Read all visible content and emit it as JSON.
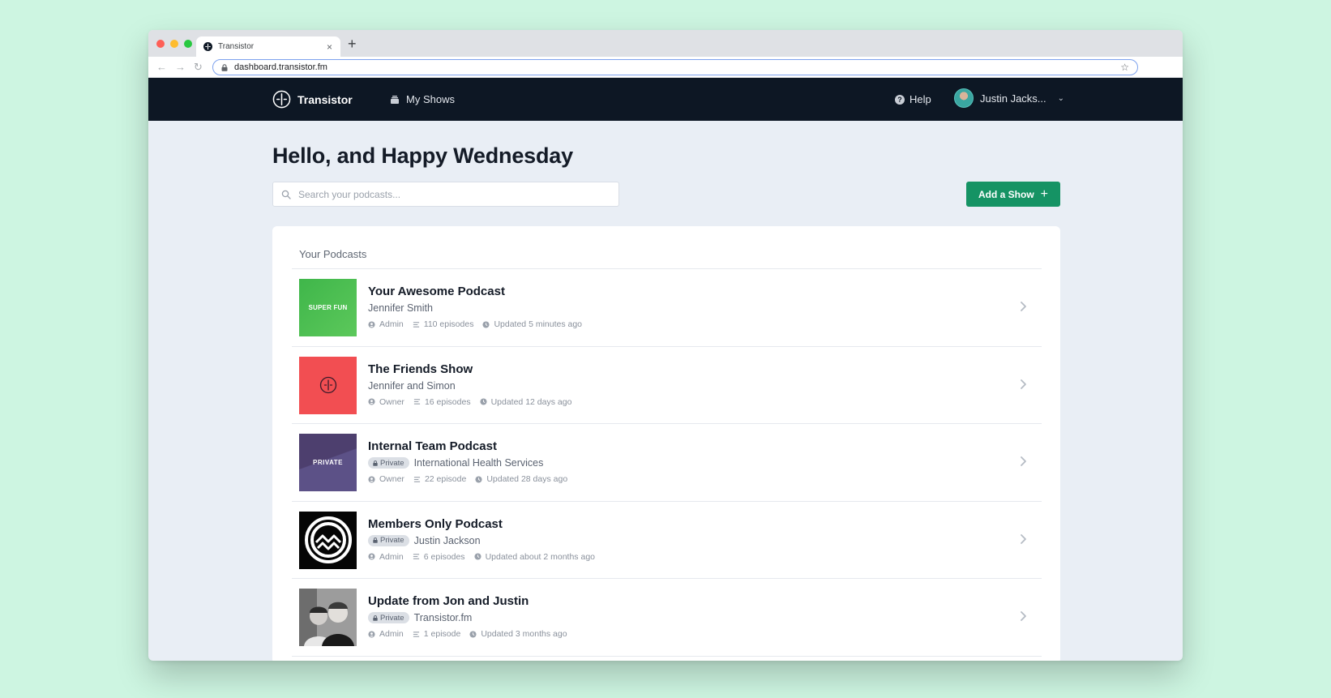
{
  "browser": {
    "tab_title": "Transistor",
    "tab_close": "×",
    "new_tab": "+",
    "url": "dashboard.transistor.fm",
    "back": "←",
    "forward": "→",
    "reload": "↻",
    "star": "☆"
  },
  "header": {
    "brand": "Transistor",
    "my_shows": "My Shows",
    "help": "Help",
    "help_glyph": "?",
    "user_name": "Justin Jacks...",
    "user_chevron": "⌄"
  },
  "main": {
    "greeting": "Hello, and Happy Wednesday",
    "search_placeholder": "Search your podcasts...",
    "add_show": "Add a Show",
    "add_show_plus": "+",
    "section_title": "Your Podcasts"
  },
  "private_label": "Private",
  "podcasts": [
    {
      "title": "Your Awesome Podcast",
      "author": "Jennifer Smith",
      "art_text": "SUPER FUN",
      "role": "Admin",
      "episodes": "110 episodes",
      "updated": "Updated 5 minutes ago"
    },
    {
      "title": "The Friends Show",
      "author": "Jennifer and Simon",
      "role": "Owner",
      "episodes": "16 episodes",
      "updated": "Updated 12 days ago"
    },
    {
      "title": "Internal Team Podcast",
      "author": "International Health Services",
      "art_text": "PRIVATE",
      "role": "Owner",
      "episodes": "22 episode",
      "updated": "Updated 28 days ago"
    },
    {
      "title": "Members Only Podcast",
      "author": "Justin Jackson",
      "role": "Admin",
      "episodes": "6 episodes",
      "updated": "Updated about 2 months ago"
    },
    {
      "title": "Update from Jon and Justin",
      "author": "Transistor.fm",
      "role": "Admin",
      "episodes": "1 episode",
      "updated": "Updated 3 months ago"
    }
  ],
  "colors": {
    "background": "#cdf5e1",
    "nav": "#0d1724",
    "accent": "#159364",
    "superfun": "#3fb64a",
    "friends": "#f24e52",
    "private_art": "#4d3f6e"
  }
}
